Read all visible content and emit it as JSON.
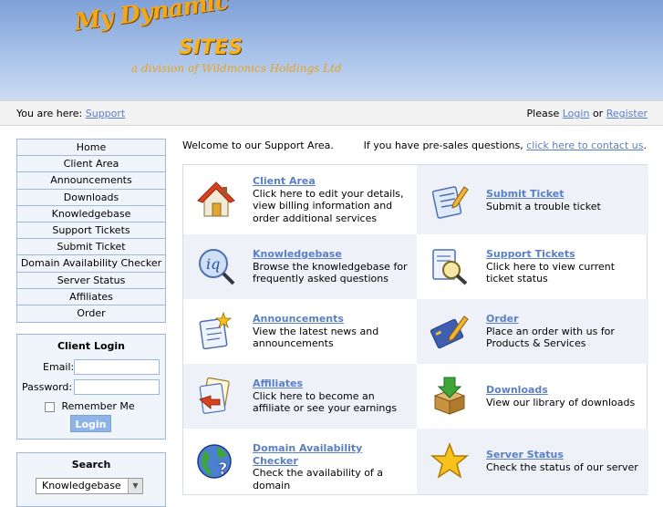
{
  "logo": {
    "line1": "My Dynamic",
    "line2": "SITES",
    "line3": "a division of Wildmonics Holdings Ltd"
  },
  "breadcrumb": {
    "prefix": "You are here:",
    "link": "Support",
    "please": "Please",
    "login": "Login",
    "or": "or",
    "register": "Register"
  },
  "nav": {
    "items": [
      "Home",
      "Client Area",
      "Announcements",
      "Downloads",
      "Knowledgebase",
      "Support Tickets",
      "Submit Ticket",
      "Domain Availability Checker",
      "Server Status",
      "Affiliates",
      "Order"
    ]
  },
  "login": {
    "title": "Client Login",
    "email_label": "Email:",
    "password_label": "Password:",
    "remember": "Remember Me",
    "button": "Login"
  },
  "search": {
    "title": "Search",
    "selected": "Knowledgebase"
  },
  "main": {
    "welcome": "Welcome to our Support Area.",
    "presales_text": "If you have pre-sales questions,",
    "presales_link": "click here to contact us",
    "presales_end": ".",
    "cells": [
      {
        "title": "Client Area",
        "desc": "Click here to edit your details, view billing information and order additional services"
      },
      {
        "title": "Submit Ticket",
        "desc": "Submit a trouble ticket"
      },
      {
        "title": "Knowledgebase",
        "desc": "Browse the knowledgebase for frequently asked questions"
      },
      {
        "title": "Support Tickets",
        "desc": "Click here to view current ticket status"
      },
      {
        "title": "Announcements",
        "desc": "View the latest news and announcements"
      },
      {
        "title": "Order",
        "desc": "Place an order with us for Products & Services"
      },
      {
        "title": "Affiliates",
        "desc": "Click here to become an affiliate or see your earnings"
      },
      {
        "title": "Downloads",
        "desc": "View our library of downloads"
      },
      {
        "title": "Domain Availability Checker",
        "desc": "Check the availability of a domain"
      },
      {
        "title": "Server Status",
        "desc": "Check the status of our server"
      }
    ]
  },
  "colors": {
    "link": "#5a7fc4",
    "header_top": "#7fa1d8",
    "nav_border": "#9fb7dc",
    "nav_bg": "#f0f5fc",
    "logo_orange": "#f4a619"
  }
}
